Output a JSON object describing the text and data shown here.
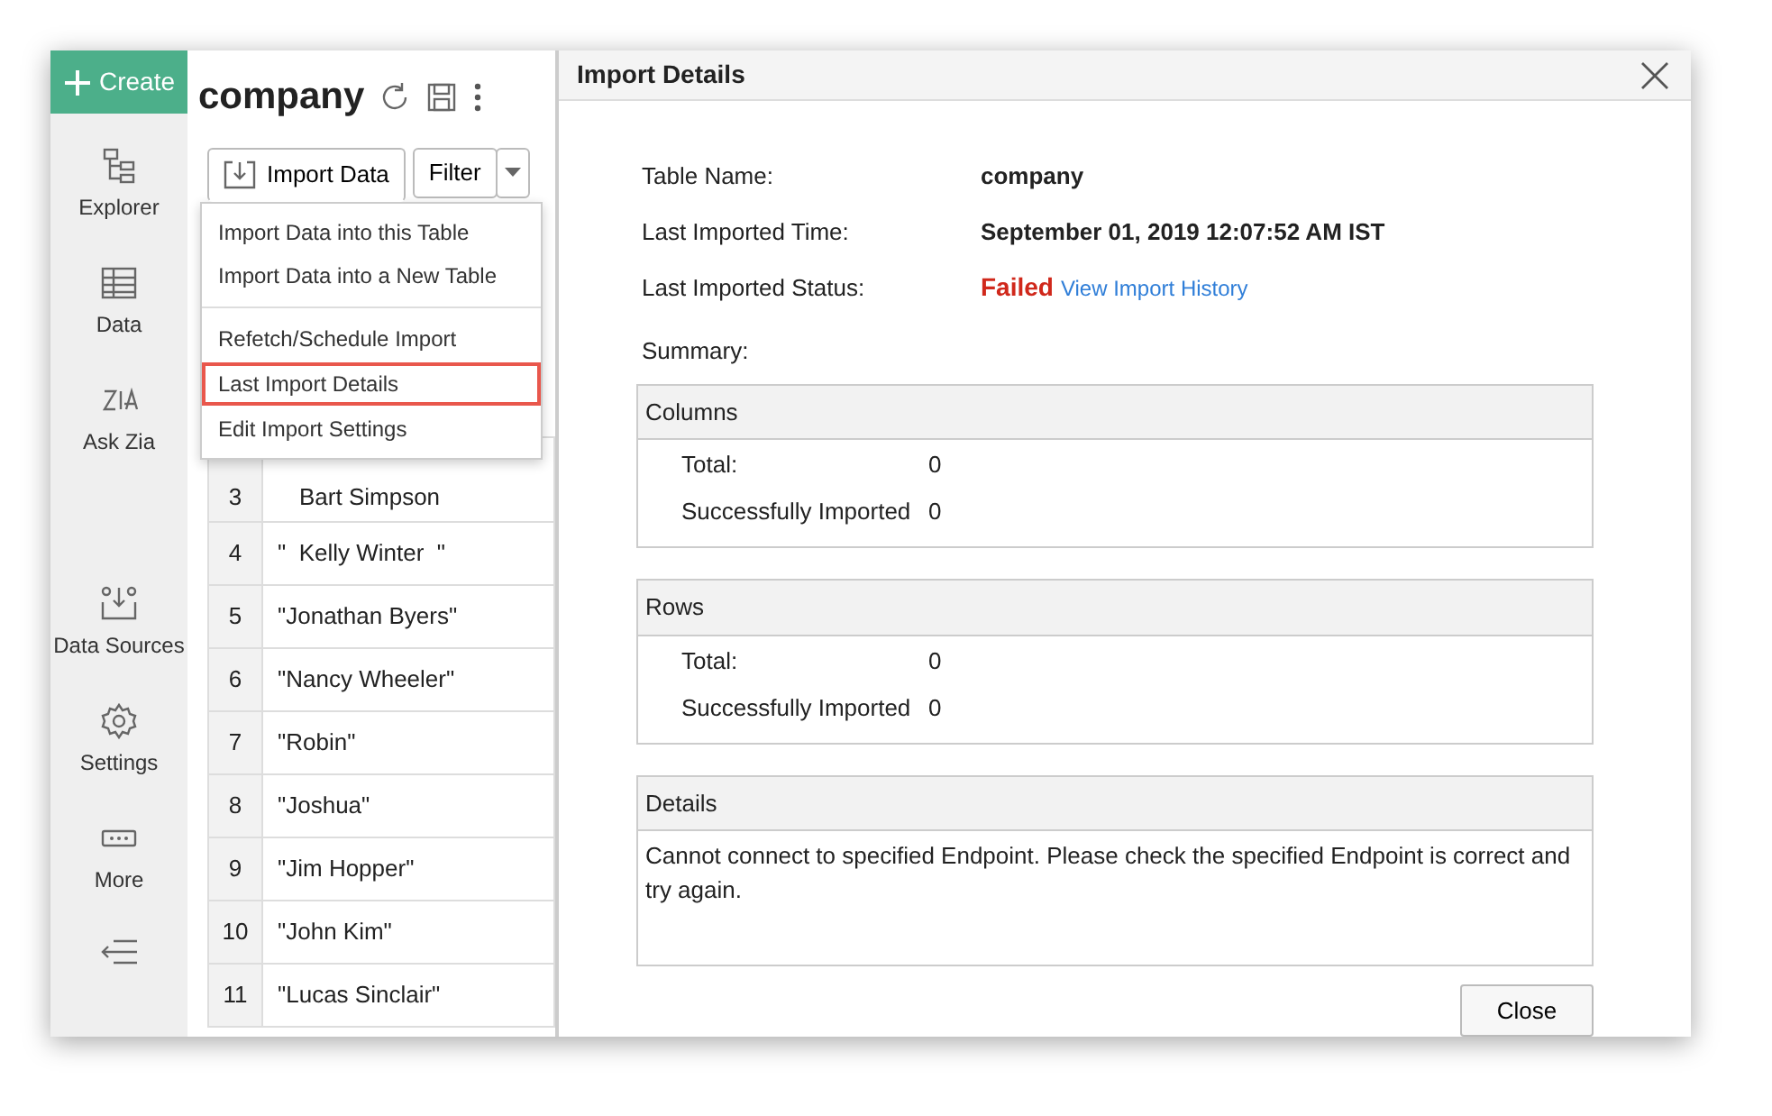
{
  "sidebar": {
    "create_label": "Create",
    "items": [
      {
        "kind": "explorer",
        "label": "Explorer"
      },
      {
        "kind": "data",
        "label": "Data"
      },
      {
        "kind": "zia",
        "label": "Ask Zia"
      },
      {
        "kind": "sources",
        "label": "Data Sources"
      },
      {
        "kind": "settings",
        "label": "Settings"
      },
      {
        "kind": "more",
        "label": "More"
      }
    ]
  },
  "workspace": {
    "title": "company",
    "import_button": "Import Data",
    "filter_button": "Filter",
    "import_menu": [
      {
        "label": "Import Data into this Table",
        "selected": false,
        "divider_before": false
      },
      {
        "label": "Import Data into a New Table",
        "selected": false,
        "divider_before": false
      },
      {
        "label": "Refetch/Schedule Import",
        "selected": false,
        "divider_before": true
      },
      {
        "label": "Last Import Details",
        "selected": true,
        "divider_before": false
      },
      {
        "label": "Edit Import Settings",
        "selected": false,
        "divider_before": false
      }
    ],
    "rows": [
      {
        "number": "3",
        "name": "Bart Simpson"
      },
      {
        "number": "4",
        "name": "\"  Kelly Winter  \""
      },
      {
        "number": "5",
        "name": "\"Jonathan Byers\""
      },
      {
        "number": "6",
        "name": "\"Nancy Wheeler\""
      },
      {
        "number": "7",
        "name": "\"Robin\""
      },
      {
        "number": "8",
        "name": "\"Joshua\""
      },
      {
        "number": "9",
        "name": "\"Jim Hopper\""
      },
      {
        "number": "10",
        "name": "\"John Kim\""
      },
      {
        "number": "11",
        "name": "\"Lucas Sinclair\""
      }
    ]
  },
  "dialog": {
    "title": "Import Details",
    "fields": [
      {
        "label": "Table Name:",
        "value": "company"
      },
      {
        "label": "Last Imported Time:",
        "value": "September 01, 2019 12:07:52 AM IST"
      },
      {
        "label": "Last Imported Status:",
        "value": "Failed",
        "error": true,
        "link": "View Import History"
      }
    ],
    "summary_label": "Summary:",
    "sections": [
      {
        "title": "Columns",
        "rows": [
          {
            "label": "Total:",
            "value": "0"
          },
          {
            "label": "Successfully Imported",
            "value": "0"
          }
        ]
      },
      {
        "title": "Rows",
        "rows": [
          {
            "label": "Total:",
            "value": "0"
          },
          {
            "label": "Successfully Imported",
            "value": "0"
          }
        ]
      }
    ],
    "details": {
      "title": "Details",
      "text": "Cannot connect to specified Endpoint. Please check the specified Endpoint is correct and try again."
    },
    "close_button": "Close"
  }
}
